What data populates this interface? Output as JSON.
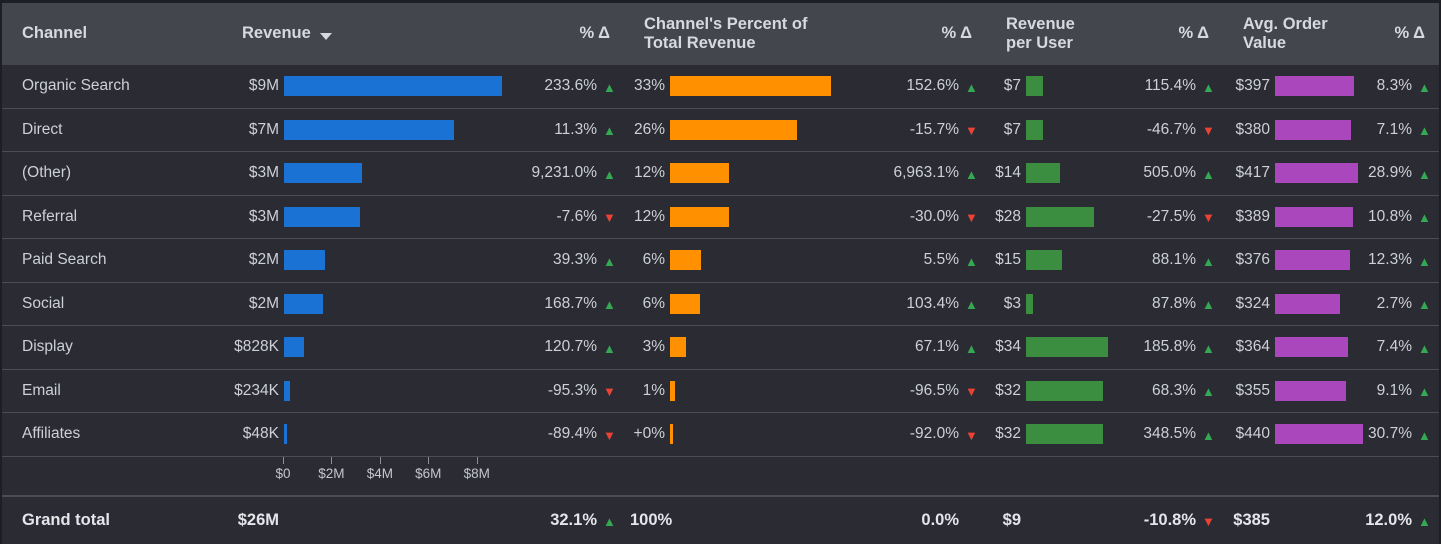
{
  "colors": {
    "background": "#2b2c33",
    "header_background": "#44464e",
    "text": "#cdd0d6",
    "grid": "#4b4d55",
    "revenue_bar": "#1a73d4",
    "percent_bar": "#ff9100",
    "rpu_bar": "#3b8e3f",
    "aov_bar": "#aa47bc",
    "up": "#34a853",
    "down": "#ea4335"
  },
  "header": {
    "dimension": "Channel",
    "revenue": "Revenue",
    "revenue_sort_icon": "caret-down-icon",
    "delta1": "% Δ",
    "pct_total": "Channel's Percent of\nTotal Revenue",
    "pct_total_line1": "Channel's Percent of",
    "pct_total_line2": "Total Revenue",
    "delta2": "% Δ",
    "rpu_line1": "Revenue",
    "rpu_line2": "per User",
    "delta3": "% Δ",
    "aov_line1": "Avg. Order",
    "aov_line2": "Value",
    "delta4": "% Δ"
  },
  "axis": {
    "ticks": [
      "$0",
      "$2M",
      "$4M",
      "$6M",
      "$8M"
    ],
    "tick_values": [
      0,
      2,
      4,
      6,
      8
    ],
    "max": 9.0
  },
  "chart_data": {
    "type": "table",
    "title": "Channel performance table with inline bar charts",
    "columns": [
      "Channel",
      "Revenue",
      "% Δ",
      "Channel's Percent of Total Revenue",
      "% Δ",
      "Revenue per User",
      "% Δ",
      "Avg. Order Value",
      "% Δ"
    ],
    "categories": [
      "Organic Search",
      "Direct",
      "(Other)",
      "Referral",
      "Paid Search",
      "Social",
      "Display",
      "Email",
      "Affiliates"
    ],
    "series": [
      {
        "name": "Revenue",
        "values": [
          9.0,
          7.0,
          3.0,
          3.0,
          2.0,
          2.0,
          0.828,
          0.234,
          0.048
        ],
        "labels": [
          "$9M",
          "$7M",
          "$3M",
          "$3M",
          "$2M",
          "$2M",
          "$828K",
          "$234K",
          "$48K"
        ],
        "max": 9.0,
        "color": "#1a73d4"
      },
      {
        "name": "Channel's Percent of Total Revenue",
        "values": [
          33,
          26,
          12,
          12,
          6,
          6,
          3,
          1,
          0
        ],
        "labels": [
          "33%",
          "26%",
          "12%",
          "12%",
          "6%",
          "6%",
          "3%",
          "1%",
          "+0%"
        ],
        "max": 33,
        "color": "#ff9100"
      },
      {
        "name": "Revenue per User",
        "values": [
          7,
          7,
          14,
          28,
          15,
          3,
          34,
          32,
          32
        ],
        "labels": [
          "$7",
          "$7",
          "$14",
          "$28",
          "$15",
          "$3",
          "$34",
          "$32",
          "$32"
        ],
        "max": 34,
        "color": "#3b8e3f"
      },
      {
        "name": "Avg. Order Value",
        "values": [
          397,
          380,
          417,
          389,
          376,
          324,
          364,
          355,
          440
        ],
        "labels": [
          "$397",
          "$380",
          "$417",
          "$389",
          "$376",
          "$324",
          "$364",
          "$355",
          "$440"
        ],
        "max": 440,
        "color": "#aa47bc"
      }
    ],
    "deltas": [
      {
        "name": "Revenue % Δ",
        "values": [
          "233.6%",
          "11.3%",
          "9,231.0%",
          "-7.6%",
          "39.3%",
          "168.7%",
          "120.7%",
          "-95.3%",
          "-89.4%"
        ],
        "dirs": [
          "up",
          "up",
          "up",
          "down",
          "up",
          "up",
          "up",
          "down",
          "down"
        ]
      },
      {
        "name": "Percent of Total % Δ",
        "values": [
          "152.6%",
          "-15.7%",
          "6,963.1%",
          "-30.0%",
          "5.5%",
          "103.4%",
          "67.1%",
          "-96.5%",
          "-92.0%"
        ],
        "dirs": [
          "up",
          "down",
          "up",
          "down",
          "up",
          "up",
          "up",
          "down",
          "down"
        ]
      },
      {
        "name": "Revenue per User % Δ",
        "values": [
          "115.4%",
          "-46.7%",
          "505.0%",
          "-27.5%",
          "88.1%",
          "87.8%",
          "185.8%",
          "68.3%",
          "348.5%"
        ],
        "dirs": [
          "up",
          "down",
          "up",
          "down",
          "up",
          "up",
          "up",
          "up",
          "up"
        ]
      },
      {
        "name": "Avg. Order Value % Δ",
        "values": [
          "8.3%",
          "7.1%",
          "28.9%",
          "10.8%",
          "12.3%",
          "2.7%",
          "7.4%",
          "9.1%",
          "30.7%"
        ],
        "dirs": [
          "up",
          "up",
          "up",
          "up",
          "up",
          "up",
          "up",
          "up",
          "up"
        ]
      }
    ]
  },
  "rows": [
    {
      "channel": "Organic Search",
      "revenue": "$9M",
      "revenue_v": 9.0,
      "d1": "233.6%",
      "d1dir": "up",
      "pct": "33%",
      "pct_v": 33,
      "d2": "152.6%",
      "d2dir": "up",
      "rpu": "$7",
      "rpu_v": 7,
      "d3": "115.4%",
      "d3dir": "up",
      "aov": "$397",
      "aov_v": 397,
      "d4": "8.3%",
      "d4dir": "up"
    },
    {
      "channel": "Direct",
      "revenue": "$7M",
      "revenue_v": 7.0,
      "d1": "11.3%",
      "d1dir": "up",
      "pct": "26%",
      "pct_v": 26,
      "d2": "-15.7%",
      "d2dir": "down",
      "rpu": "$7",
      "rpu_v": 7,
      "d3": "-46.7%",
      "d3dir": "down",
      "aov": "$380",
      "aov_v": 380,
      "d4": "7.1%",
      "d4dir": "up"
    },
    {
      "channel": "(Other)",
      "revenue": "$3M",
      "revenue_v": 3.2,
      "d1": "9,231.0%",
      "d1dir": "up",
      "pct": "12%",
      "pct_v": 12,
      "d2": "6,963.1%",
      "d2dir": "up",
      "rpu": "$14",
      "rpu_v": 14,
      "d3": "505.0%",
      "d3dir": "up",
      "aov": "$417",
      "aov_v": 417,
      "d4": "28.9%",
      "d4dir": "up"
    },
    {
      "channel": "Referral",
      "revenue": "$3M",
      "revenue_v": 3.15,
      "d1": "-7.6%",
      "d1dir": "down",
      "pct": "12%",
      "pct_v": 12,
      "d2": "-30.0%",
      "d2dir": "down",
      "rpu": "$28",
      "rpu_v": 28,
      "d3": "-27.5%",
      "d3dir": "down",
      "aov": "$389",
      "aov_v": 389,
      "d4": "10.8%",
      "d4dir": "up"
    },
    {
      "channel": "Paid Search",
      "revenue": "$2M",
      "revenue_v": 1.7,
      "d1": "39.3%",
      "d1dir": "up",
      "pct": "6%",
      "pct_v": 6.4,
      "d2": "5.5%",
      "d2dir": "up",
      "rpu": "$15",
      "rpu_v": 15,
      "d3": "88.1%",
      "d3dir": "up",
      "aov": "$376",
      "aov_v": 376,
      "d4": "12.3%",
      "d4dir": "up"
    },
    {
      "channel": "Social",
      "revenue": "$2M",
      "revenue_v": 1.62,
      "d1": "168.7%",
      "d1dir": "up",
      "pct": "6%",
      "pct_v": 6.2,
      "d2": "103.4%",
      "d2dir": "up",
      "rpu": "$3",
      "rpu_v": 3,
      "d3": "87.8%",
      "d3dir": "up",
      "aov": "$324",
      "aov_v": 324,
      "d4": "2.7%",
      "d4dir": "up"
    },
    {
      "channel": "Display",
      "revenue": "$828K",
      "revenue_v": 0.828,
      "d1": "120.7%",
      "d1dir": "up",
      "pct": "3%",
      "pct_v": 3.2,
      "d2": "67.1%",
      "d2dir": "up",
      "rpu": "$34",
      "rpu_v": 34,
      "d3": "185.8%",
      "d3dir": "up",
      "aov": "$364",
      "aov_v": 364,
      "d4": "7.4%",
      "d4dir": "up"
    },
    {
      "channel": "Email",
      "revenue": "$234K",
      "revenue_v": 0.234,
      "d1": "-95.3%",
      "d1dir": "down",
      "pct": "1%",
      "pct_v": 0.95,
      "d2": "-96.5%",
      "d2dir": "down",
      "rpu": "$32",
      "rpu_v": 32,
      "d3": "68.3%",
      "d3dir": "up",
      "aov": "$355",
      "aov_v": 355,
      "d4": "9.1%",
      "d4dir": "up"
    },
    {
      "channel": "Affiliates",
      "revenue": "$48K",
      "revenue_v": 0.048,
      "d1": "-89.4%",
      "d1dir": "down",
      "pct": "+0%",
      "pct_v": 0.2,
      "d2": "-92.0%",
      "d2dir": "down",
      "rpu": "$32",
      "rpu_v": 32,
      "d3": "348.5%",
      "d3dir": "up",
      "aov": "$440",
      "aov_v": 440,
      "d4": "30.7%",
      "d4dir": "up"
    }
  ],
  "total": {
    "label": "Grand total",
    "revenue": "$26M",
    "d1": "32.1%",
    "d1dir": "up",
    "pct": "100%",
    "d2": "0.0%",
    "d2dir": "up",
    "rpu": "$9",
    "d3": "-10.8%",
    "d3dir": "down",
    "aov": "$385",
    "d4": "12.0%",
    "d4dir": "up"
  }
}
